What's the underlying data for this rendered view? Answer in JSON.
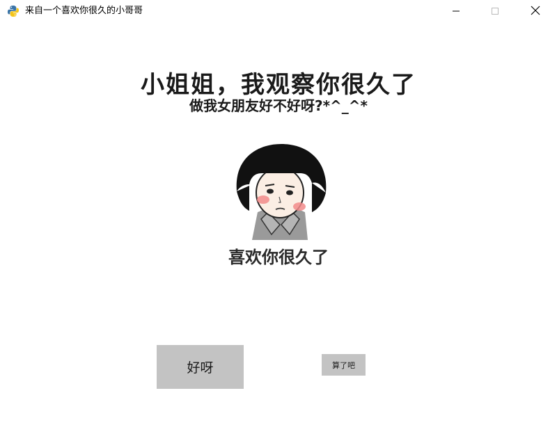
{
  "window": {
    "title": "来自一个喜欢你很久的小哥哥",
    "app_icon": "python-icon",
    "controls": {
      "minimize_icon": "minimize-icon",
      "maximize_icon": "maximize-icon",
      "close_icon": "close-icon"
    }
  },
  "main": {
    "headline": "小姐姐，我观察你很久了",
    "subline": "做我女朋友好不好呀?*^_^*",
    "meme_image": "meme-girl-image",
    "meme_caption": "喜欢你很久了"
  },
  "buttons": {
    "yes_label": "好呀",
    "no_label": "算了吧"
  },
  "colors": {
    "button_bg": "#c3c3c3",
    "background": "#ffffff",
    "text": "#1a1a1a"
  }
}
